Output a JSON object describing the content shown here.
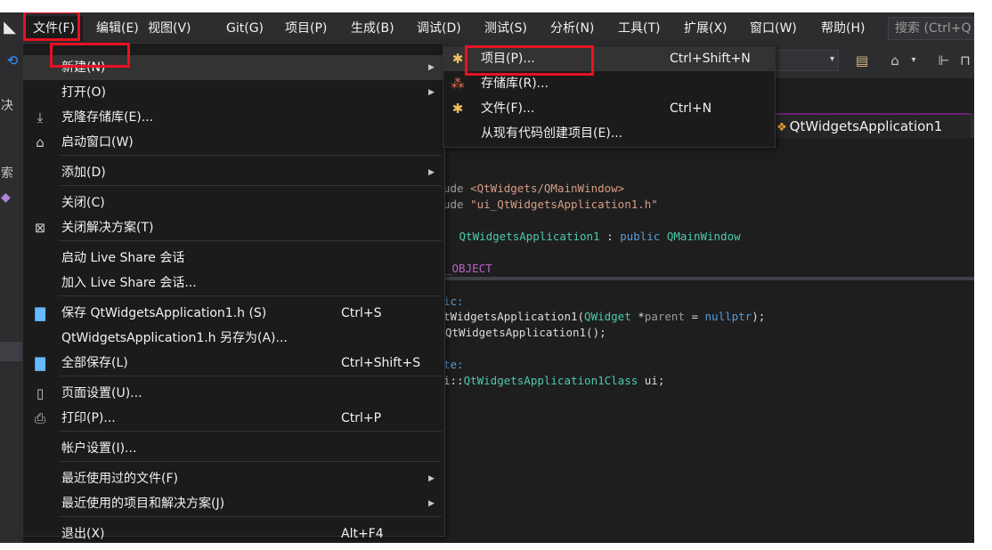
{
  "menubar": {
    "items": [
      {
        "label": "文件(F)"
      },
      {
        "label": "编辑(E)"
      },
      {
        "label": "视图(V)"
      },
      {
        "label": "Git(G)"
      },
      {
        "label": "项目(P)"
      },
      {
        "label": "生成(B)"
      },
      {
        "label": "调试(D)"
      },
      {
        "label": "测试(S)"
      },
      {
        "label": "分析(N)"
      },
      {
        "label": "工具(T)"
      },
      {
        "label": "扩展(X)"
      },
      {
        "label": "窗口(W)"
      },
      {
        "label": "帮助(H)"
      }
    ],
    "search_placeholder": "搜索 (Ctrl+Q"
  },
  "left_strip": {
    "glyphs": [
      "决",
      "索"
    ]
  },
  "editor": {
    "tab_title": "QtWidgetsApplication1",
    "code_lines": [
      [
        {
          "t": "ude ",
          "c": "gray"
        },
        {
          "t": "<QtWidgets/QMainWindow>",
          "c": "str"
        }
      ],
      [
        {
          "t": "ude ",
          "c": "gray"
        },
        {
          "t": "\"ui_QtWidgetsApplication1.h\"",
          "c": "str"
        }
      ],
      [
        {
          "t": " QtWidgetsApplication1",
          "c": "type"
        },
        {
          "t": " : ",
          "c": "plain"
        },
        {
          "t": "public",
          "c": "kw"
        },
        {
          "t": " QMainWindow",
          "c": "type"
        }
      ],
      [
        {
          "t": "_OBJECT",
          "c": "macro"
        }
      ],
      [
        {
          "t": "ic:",
          "c": "kw"
        }
      ],
      [
        {
          "t": "tWidgetsApplication1",
          "c": "plain"
        },
        {
          "t": "(",
          "c": "plain"
        },
        {
          "t": "QWidget",
          "c": "type"
        },
        {
          "t": " *",
          "c": "plain"
        },
        {
          "t": "parent",
          "c": "gray"
        },
        {
          "t": " = ",
          "c": "plain"
        },
        {
          "t": "nullptr",
          "c": "kw"
        },
        {
          "t": ");",
          "c": "plain"
        }
      ],
      [
        {
          "t": "QtWidgetsApplication1",
          "c": "plain"
        },
        {
          "t": "();",
          "c": "plain"
        }
      ],
      [
        {
          "t": "te:",
          "c": "kw"
        }
      ],
      [
        {
          "t": "i::",
          "c": "plain"
        },
        {
          "t": "QtWidgetsApplication1Class",
          "c": "type"
        },
        {
          "t": " ui;",
          "c": "plain"
        }
      ]
    ]
  },
  "file_menu": {
    "items": [
      {
        "label": "新建(N)",
        "shortcut": "",
        "icon": "",
        "submenu": true
      },
      {
        "label": "打开(O)",
        "shortcut": "",
        "icon": "",
        "submenu": true
      },
      {
        "label": "克隆存储库(E)...",
        "shortcut": "",
        "icon": "clone-icon",
        "submenu": false
      },
      {
        "label": "启动窗口(W)",
        "shortcut": "",
        "icon": "start-window-icon",
        "submenu": false
      },
      {
        "label": "添加(D)",
        "shortcut": "",
        "icon": "",
        "submenu": true
      },
      {
        "label": "关闭(C)",
        "shortcut": "",
        "icon": "",
        "submenu": false
      },
      {
        "label": "关闭解决方案(T)",
        "shortcut": "",
        "icon": "close-solution-icon",
        "submenu": false
      },
      {
        "label": "启动 Live Share 会话",
        "shortcut": "",
        "icon": "",
        "submenu": false
      },
      {
        "label": "加入 Live Share 会话...",
        "shortcut": "",
        "icon": "",
        "submenu": false
      },
      {
        "label": "保存 QtWidgetsApplication1.h (S)",
        "shortcut": "Ctrl+S",
        "icon": "save-icon",
        "submenu": false
      },
      {
        "label": "QtWidgetsApplication1.h 另存为(A)...",
        "shortcut": "",
        "icon": "",
        "submenu": false
      },
      {
        "label": "全部保存(L)",
        "shortcut": "Ctrl+Shift+S",
        "icon": "save-all-icon",
        "submenu": false
      },
      {
        "label": "页面设置(U)...",
        "shortcut": "",
        "icon": "page-setup-icon",
        "submenu": false
      },
      {
        "label": "打印(P)...",
        "shortcut": "Ctrl+P",
        "icon": "print-icon",
        "submenu": false
      },
      {
        "label": "帐户设置(I)...",
        "shortcut": "",
        "icon": "",
        "submenu": false
      },
      {
        "label": "最近使用过的文件(F)",
        "shortcut": "",
        "icon": "",
        "submenu": true
      },
      {
        "label": "最近使用的项目和解决方案(J)",
        "shortcut": "",
        "icon": "",
        "submenu": true
      },
      {
        "label": "退出(X)",
        "shortcut": "Alt+F4",
        "icon": "",
        "submenu": false
      }
    ]
  },
  "new_submenu": {
    "items": [
      {
        "label": "项目(P)...",
        "shortcut": "Ctrl+Shift+N",
        "icon": "new-project-icon"
      },
      {
        "label": "存储库(R)...",
        "shortcut": "",
        "icon": "repository-icon"
      },
      {
        "label": "文件(F)...",
        "shortcut": "Ctrl+N",
        "icon": "new-file-icon"
      },
      {
        "label": "从现有代码创建项目(E)...",
        "shortcut": "",
        "icon": ""
      }
    ]
  },
  "colors": {
    "menu_background": "#1b1b1c",
    "highlight": "#333334",
    "annotation_red": "#e81123",
    "accent": "#68217a"
  }
}
